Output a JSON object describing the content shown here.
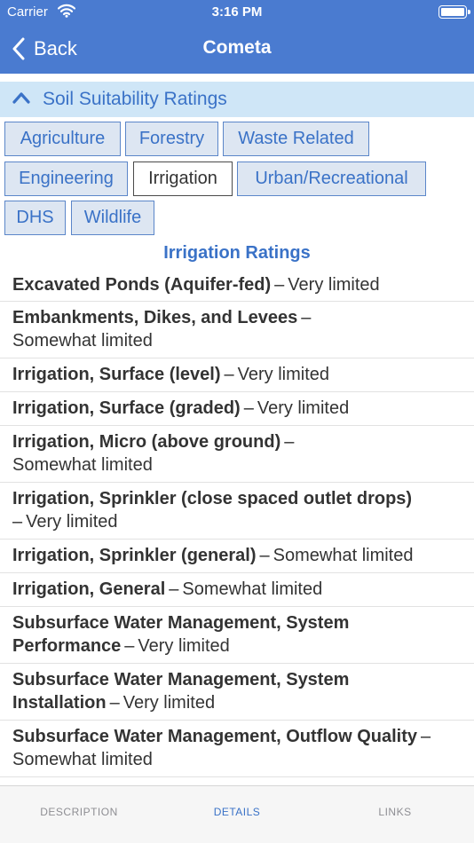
{
  "status_bar": {
    "carrier": "Carrier",
    "time": "3:16 PM"
  },
  "nav": {
    "back_label": "Back",
    "title": "Cometa"
  },
  "section": {
    "title": "Soil Suitability Ratings"
  },
  "chips": [
    "Agriculture",
    "Forestry",
    "Waste Related",
    "Engineering",
    "Irrigation",
    "Urban/Recreational",
    "DHS",
    "Wildlife"
  ],
  "selected_chip": "Irrigation",
  "ratings": {
    "title": "Irrigation Ratings",
    "separator": "–",
    "rows": [
      {
        "name": "Excavated Ponds (Aquifer-fed)",
        "value": "Very limited"
      },
      {
        "name": "Embankments, Dikes, and Levees",
        "value": "Somewhat limited"
      },
      {
        "name": "Irrigation, Surface (level)",
        "value": "Very limited"
      },
      {
        "name": "Irrigation, Surface (graded)",
        "value": "Very limited"
      },
      {
        "name": "Irrigation, Micro (above ground)",
        "value": "Somewhat limited"
      },
      {
        "name": "Irrigation, Sprinkler (close spaced outlet drops)",
        "value": "Very limited"
      },
      {
        "name": "Irrigation, Sprinkler (general)",
        "value": "Somewhat limited"
      },
      {
        "name": "Irrigation, General",
        "value": "Somewhat limited"
      },
      {
        "name": "Subsurface Water Management, System Performance",
        "value": "Very limited"
      },
      {
        "name": "Subsurface Water Management, System Installation",
        "value": "Very limited"
      },
      {
        "name": "Subsurface Water Management, Outflow Quality",
        "value": "Somewhat limited"
      }
    ]
  },
  "tabs": [
    {
      "label": "DESCRIPTION",
      "active": false
    },
    {
      "label": "DETAILS",
      "active": true
    },
    {
      "label": "LINKS",
      "active": false
    }
  ],
  "colors": {
    "nav": "#4a7bd0",
    "accent": "#3a72c7",
    "section_bg": "#cfe6f7",
    "chip_bg": "#dde6f2"
  },
  "icons": [
    "wifi-icon",
    "battery-icon",
    "back-chevron-icon",
    "collapse-chevron-icon"
  ]
}
